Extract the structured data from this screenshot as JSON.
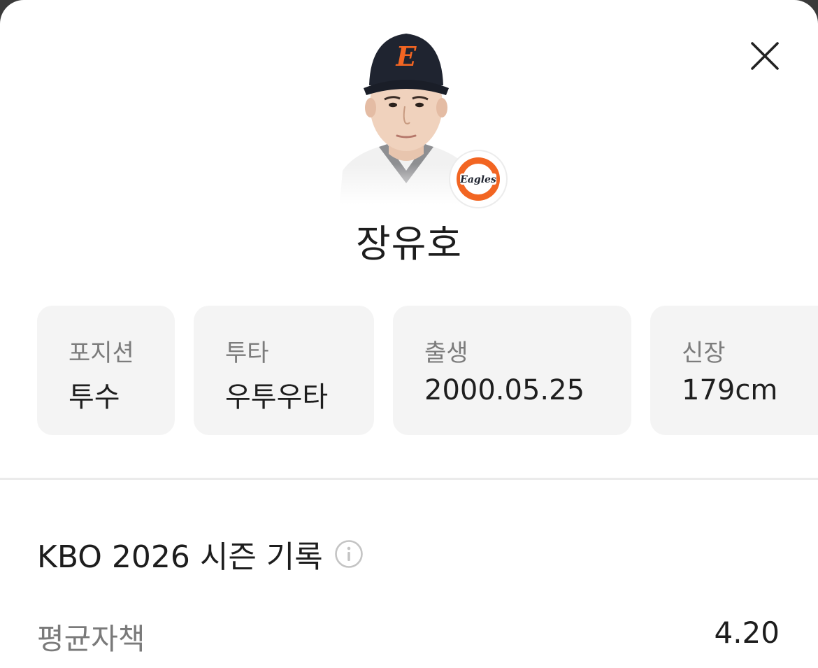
{
  "player": {
    "name": "장유호",
    "team_badge_text": "Eagles",
    "cap_letter": "E"
  },
  "info_cards": [
    {
      "label": "포지션",
      "value": "투수"
    },
    {
      "label": "투타",
      "value": "우투우타"
    },
    {
      "label": "출생",
      "value": "2000.05.25"
    },
    {
      "label": "신장",
      "value": "179cm"
    }
  ],
  "season": {
    "title": "KBO 2026 시즌 기록",
    "stats": [
      {
        "label": "평균자책",
        "value": "4.20"
      }
    ]
  },
  "icons": {
    "close": "close-icon",
    "info": "info-circle-icon"
  },
  "colors": {
    "team_orange": "#f26522",
    "cap_navy": "#1f2430",
    "card_bg": "#f4f4f4"
  }
}
